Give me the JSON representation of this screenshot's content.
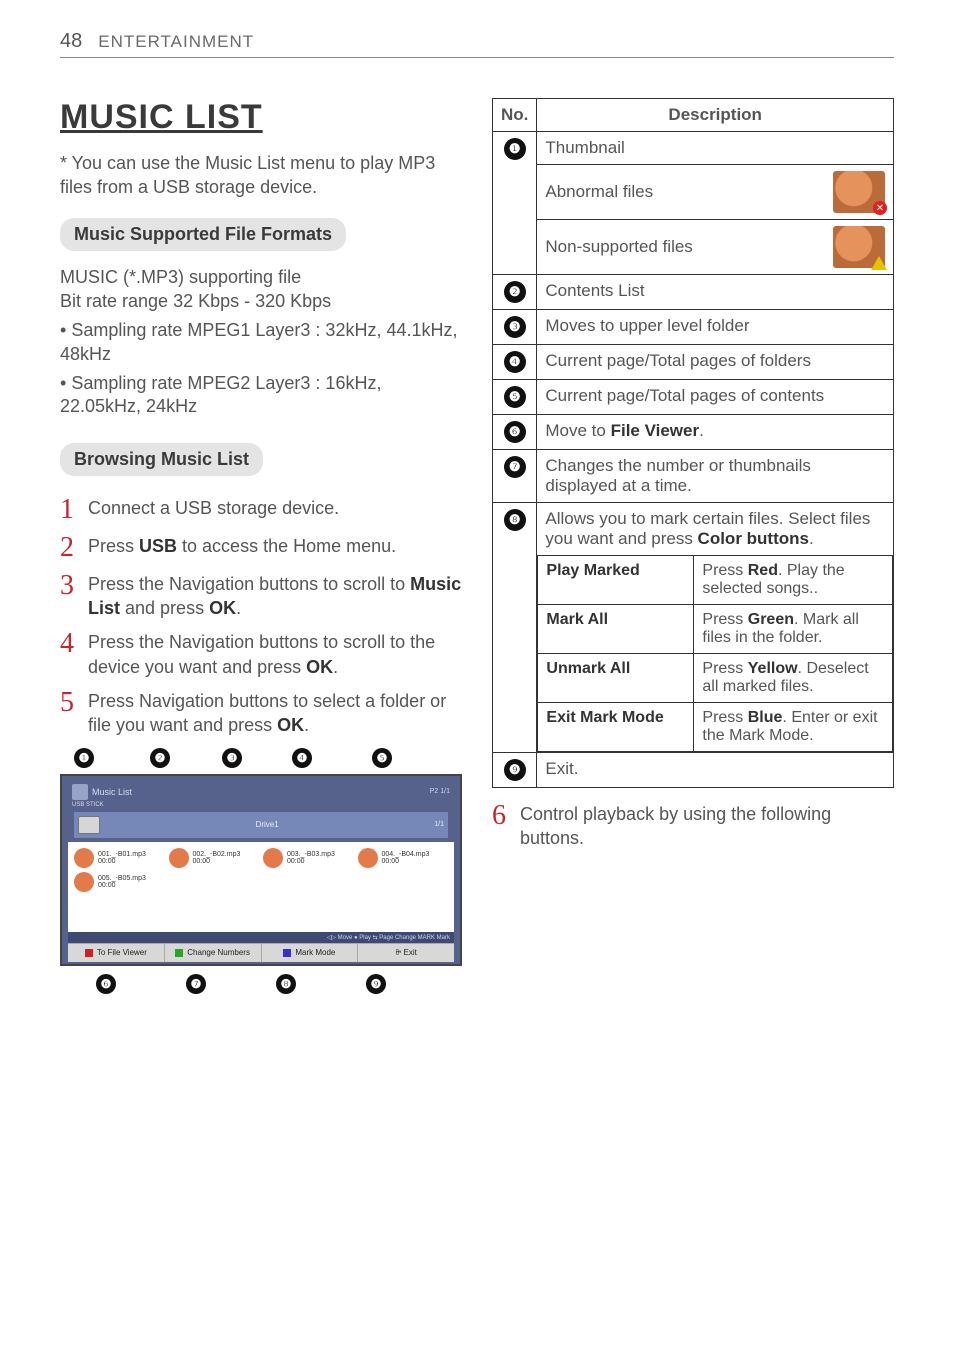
{
  "header": {
    "page_num": "48",
    "running_head": "ENTERTAINMENT"
  },
  "title": "MUSIC LIST",
  "intro": "* You can use the Music List menu to play MP3 files from a USB storage device.",
  "section1_heading": "Music Supported File Formats",
  "section1_lines": {
    "l1": "MUSIC (*.MP3) supporting file",
    "l2": "Bit rate range 32 Kbps - 320 Kbps",
    "b1": "Sampling rate MPEG1 Layer3 : 32kHz, 44.1kHz, 48kHz",
    "b2": "Sampling rate MPEG2 Layer3 : 16kHz, 22.05kHz, 24kHz"
  },
  "section2_heading": "Browsing Music List",
  "steps": {
    "s1": "Connect a USB storage device.",
    "s2_a": "Press ",
    "s2_b": "USB",
    "s2_c": " to access the Home menu.",
    "s3_a": "Press the Navigation buttons to scroll to ",
    "s3_b": "Music List",
    "s3_c": " and press ",
    "s3_d": "OK",
    "s3_e": ".",
    "s4_a": "Press the Navigation buttons to scroll to the device you want and press ",
    "s4_b": "OK",
    "s4_c": ".",
    "s5_a": "Press Navigation buttons to select a folder or file you want and press ",
    "s5_b": "OK",
    "s5_c": ".",
    "s6": "Control playback by using the following buttons."
  },
  "step_numbers": {
    "n1": "1",
    "n2": "2",
    "n3": "3",
    "n4": "4",
    "n5": "5",
    "n6": "6"
  },
  "ui_preview": {
    "title": "Music List",
    "usb_stick": "USB STICK",
    "drive": "Drive1",
    "page_top": "P2    1/1",
    "page_corner": "1/1",
    "files": [
      {
        "name": "001._-B01.mp3",
        "dur": "00:00"
      },
      {
        "name": "002._-B02.mp3",
        "dur": "00:00"
      },
      {
        "name": "003._-B03.mp3",
        "dur": "00:00"
      },
      {
        "name": "004._-B04.mp3",
        "dur": "00:00"
      },
      {
        "name": "005._-B05.mp3",
        "dur": "00:00"
      }
    ],
    "footer_hints": "◁▷ Move   ● Play   ⇆ Page Change   MARK Mark",
    "buttons": {
      "b1": "To File Viewer",
      "b2": "Change Numbers",
      "b3": "Mark Mode",
      "b4": "ꔭ Exit"
    }
  },
  "callouts": {
    "c1": "❶",
    "c2": "❷",
    "c3": "❸",
    "c4": "❹",
    "c5": "❺",
    "c6": "❻",
    "c7": "❼",
    "c8": "❽",
    "c9": "❾"
  },
  "table": {
    "headers": {
      "no": "No.",
      "desc": "Description"
    },
    "rows": {
      "r1_a": "Thumbnail",
      "r1_b": "Abnormal files",
      "r1_c": "Non-supported files",
      "r2": "Contents List",
      "r3": "Moves to upper level folder",
      "r4": "Current page/Total pages of folders",
      "r5": "Current page/Total pages of contents",
      "r6_a": "Move to ",
      "r6_b": "File Viewer",
      "r6_c": ".",
      "r7": "Changes the number or thumbnails displayed at a time.",
      "r8_a": "Allows you to mark certain files. Select files you want and press ",
      "r8_b": "Color buttons",
      "r8_c": ".",
      "sub": {
        "play_marked": "Play Marked",
        "play_marked_desc_a": "Press ",
        "play_marked_desc_b": "Red",
        "play_marked_desc_c": ". Play the selected songs..",
        "mark_all": "Mark All",
        "mark_all_desc_a": "Press ",
        "mark_all_desc_b": "Green",
        "mark_all_desc_c": ". Mark all files in the folder.",
        "unmark_all": "Unmark All",
        "unmark_all_desc_a": "Press ",
        "unmark_all_desc_b": "Yellow",
        "unmark_all_desc_c": ". Deselect all marked files.",
        "exit_mode": "Exit Mark Mode",
        "exit_mode_desc_a": "Press ",
        "exit_mode_desc_b": "Blue",
        "exit_mode_desc_c": ". Enter or exit the Mark Mode."
      },
      "r9": "Exit."
    }
  }
}
